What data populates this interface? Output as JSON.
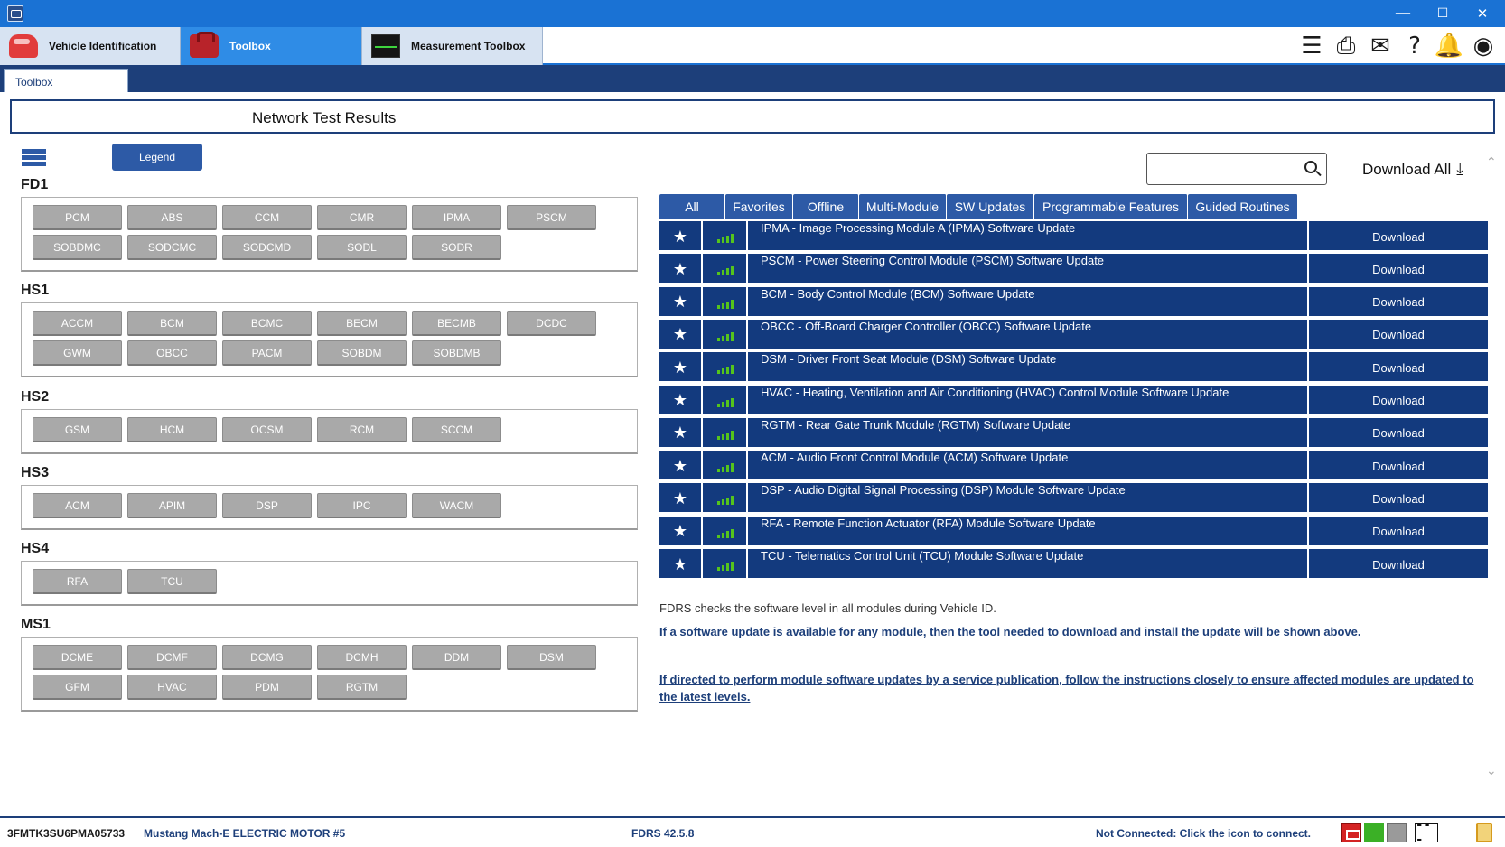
{
  "window": {
    "minimize": "—",
    "maximize": "☐",
    "close": "✕"
  },
  "tabs": [
    {
      "label": "Vehicle Identification",
      "icon": "car-icon"
    },
    {
      "label": "Toolbox",
      "icon": "toolbox-icon"
    },
    {
      "label": "Measurement Toolbox",
      "icon": "oscilloscope-icon"
    }
  ],
  "toolbar_icons": [
    "menu-icon",
    "printer-icon",
    "mail-icon",
    "help-icon",
    "bell-icon",
    "wireless-icon"
  ],
  "subtab": "Toolbox",
  "header_title": "Network Test Results",
  "legend_label": "Legend",
  "groups": [
    {
      "name": "FD1",
      "rows": [
        [
          "PCM",
          "ABS",
          "CCM",
          "CMR",
          "IPMA",
          "PSCM"
        ],
        [
          "SOBDMC",
          "SODCMC",
          "SODCMD",
          "SODL",
          "SODR"
        ]
      ]
    },
    {
      "name": "HS1",
      "rows": [
        [
          "ACCM",
          "BCM",
          "BCMC",
          "BECM",
          "BECMB",
          "DCDC"
        ],
        [
          "GWM",
          "OBCC",
          "PACM",
          "SOBDM",
          "SOBDMB"
        ]
      ]
    },
    {
      "name": "HS2",
      "rows": [
        [
          "GSM",
          "HCM",
          "OCSM",
          "RCM",
          "SCCM"
        ]
      ]
    },
    {
      "name": "HS3",
      "rows": [
        [
          "ACM",
          "APIM",
          "DSP",
          "IPC",
          "WACM"
        ]
      ]
    },
    {
      "name": "HS4",
      "rows": [
        [
          "RFA",
          "TCU"
        ]
      ]
    },
    {
      "name": "MS1",
      "rows": [
        [
          "DCME",
          "DCMF",
          "DCMG",
          "DCMH",
          "DDM",
          "DSM"
        ],
        [
          "GFM",
          "HVAC",
          "PDM",
          "RGTM"
        ]
      ]
    }
  ],
  "search": {
    "placeholder": ""
  },
  "download_all": "Download All",
  "filter_tabs": [
    "All",
    "Favorites",
    "Offline",
    "Multi-Module",
    "SW Updates",
    "Programmable Features",
    "Guided Routines"
  ],
  "updates": [
    {
      "desc": "IPMA - Image Processing Module A (IPMA) Software Update",
      "action": "Download"
    },
    {
      "desc": "PSCM - Power Steering Control Module (PSCM) Software Update",
      "action": "Download"
    },
    {
      "desc": "BCM - Body Control Module (BCM) Software Update",
      "action": "Download"
    },
    {
      "desc": "OBCC - Off-Board Charger Controller (OBCC) Software Update",
      "action": "Download"
    },
    {
      "desc": "DSM - Driver Front Seat Module (DSM) Software Update",
      "action": "Download"
    },
    {
      "desc": "HVAC - Heating, Ventilation and Air Conditioning (HVAC) Control Module Software Update",
      "action": "Download"
    },
    {
      "desc": "RGTM - Rear Gate Trunk Module (RGTM) Software Update",
      "action": "Download"
    },
    {
      "desc": "ACM - Audio Front Control Module (ACM) Software Update",
      "action": "Download"
    },
    {
      "desc": "DSP - Audio Digital Signal Processing (DSP) Module Software Update",
      "action": "Download"
    },
    {
      "desc": "RFA - Remote Function Actuator (RFA) Module Software Update",
      "action": "Download"
    },
    {
      "desc": "TCU - Telematics Control Unit (TCU) Module Software Update",
      "action": "Download"
    }
  ],
  "info": {
    "line1": "FDRS checks the software level in all modules during Vehicle ID.",
    "line2": "If a software update is available for any module, then the tool needed to download and install the update will be shown above.",
    "line3": "If directed to perform module software updates by a service publication, follow the instructions closely to ensure affected modules are updated to the latest levels."
  },
  "status": {
    "vin": "3FMTK3SU6PMA05733",
    "vehicle": "Mustang Mach-E ELECTRIC MOTOR #5",
    "version": "FDRS 42.5.8",
    "connection": "Not Connected: Click the icon to connect.",
    "dash_label": "---"
  },
  "colors": {
    "accent": "#1a72d4",
    "navy": "#133a7e",
    "module_gray": "#a9a9a9",
    "signal_green": "#55c41c"
  }
}
